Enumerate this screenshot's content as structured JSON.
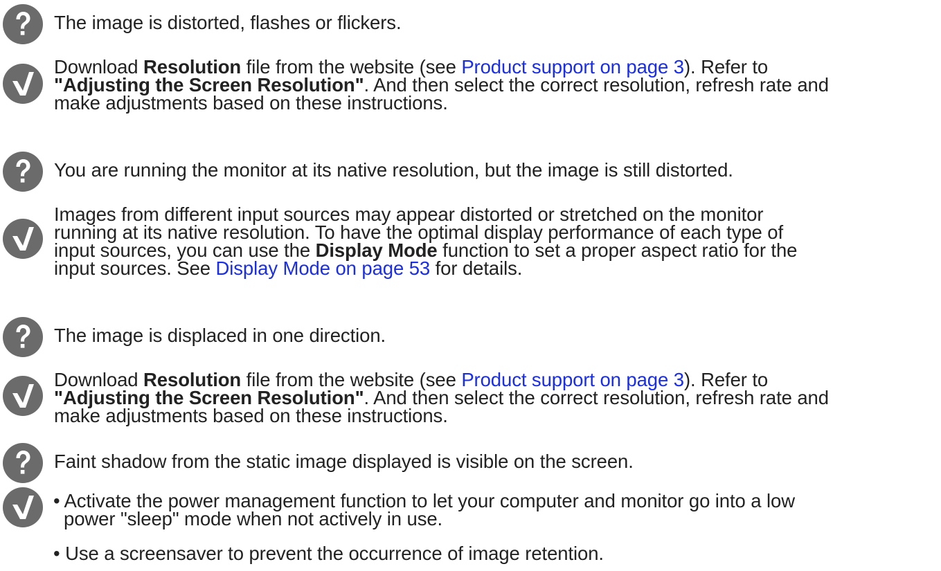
{
  "colors": {
    "icon": "#6b6b6b",
    "text": "#222222",
    "link": "#1a2ee8"
  },
  "icons": {
    "question": "question-mark-icon",
    "answer": "check-mark-icon"
  },
  "sections": [
    {
      "problem": "The image is distorted, flashes or flickers.",
      "solution": {
        "l1_pre": "Download ",
        "l1_bold": "Resolution",
        "l1_mid": " file from the website (see ",
        "l1_link": "Product support on page 3",
        "l1_post": "). Refer to",
        "l2_bold": "\"Adjusting the Screen Resolution\"",
        "l2_post": ". And then select the correct resolution, refresh rate and",
        "l3": "make adjustments based on these instructions."
      }
    },
    {
      "problem": "You are running the monitor at its native resolution, but the image is still distorted.",
      "solution": {
        "l1": "Images from different input sources may appear distorted or stretched on the monitor",
        "l2": "running at its native resolution. To have the optimal display performance of each type of",
        "l3_pre": "input sources, you can use the ",
        "l3_bold": "Display Mode",
        "l3_post": " function to set a proper aspect ratio for the",
        "l4_pre": "input sources. See ",
        "l4_link": "Display Mode on page 53",
        "l4_post": " for details."
      }
    },
    {
      "problem": "The image is displaced in one direction.",
      "solution": {
        "l1_pre": "Download ",
        "l1_bold": "Resolution",
        "l1_mid": " file from the website (see ",
        "l1_link": "Product support on page 3",
        "l1_post": "). Refer to",
        "l2_bold": "\"Adjusting the Screen Resolution\"",
        "l2_post": ". And then select the correct resolution, refresh rate and",
        "l3": "make adjustments based on these instructions."
      }
    },
    {
      "problem": "Faint shadow from the static image displayed is visible on the screen.",
      "solution": {
        "bullet": "•",
        "b1_l1": " Activate the power management function to let your computer and monitor go into a low",
        "b1_l2": "power \"sleep\" mode when not actively in use.",
        "b2": " Use a screensaver to prevent the occurrence of image retention."
      }
    }
  ]
}
